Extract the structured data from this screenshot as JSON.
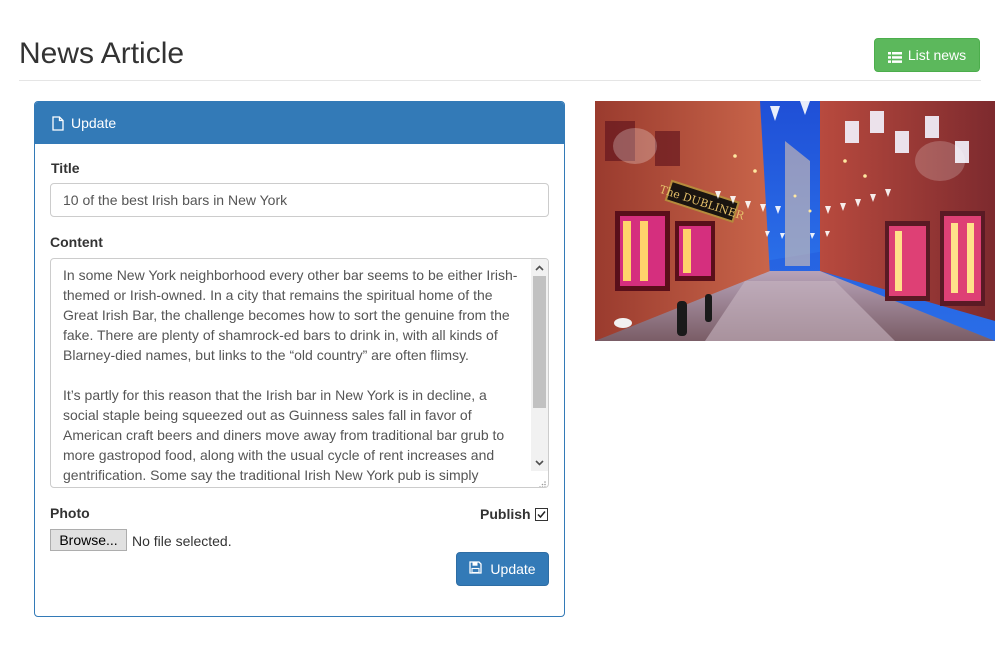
{
  "header": {
    "title": "News Article",
    "list_button_label": "List news"
  },
  "panel": {
    "heading": "Update",
    "title_label": "Title",
    "title_value": "10 of the best Irish bars in New York",
    "content_label": "Content",
    "content_value": "In some New York neighborhood every other bar seems to be either Irish-themed or Irish-owned. In a city that remains the spiritual home of the Great Irish Bar, the challenge becomes how to sort the genuine from the fake. There are plenty of shamrock-ed bars to drink in, with all kinds of Blarney-died names, but links to the “old country” are often flimsy.\n\nIt’s partly for this reason that the Irish bar in New York is in decline, a social staple being squeezed out as Guinness sales fall in favor of American craft beers and diners move away from traditional bar grub to more gastropod food, along with the usual cycle of rent increases and gentrification. Some say the traditional Irish New York pub is simply",
    "photo_label": "Photo",
    "browse_label": "Browse...",
    "file_status": "No file selected.",
    "publish_label": "Publish",
    "publish_checked": true,
    "update_button_label": "Update"
  },
  "photo": {
    "sign_text": "The DUBLINER"
  },
  "colors": {
    "primary": "#337ab7",
    "success": "#5cb85c"
  },
  "icons": {
    "list_button": "list-icon",
    "heading": "file-icon",
    "update_button": "floppy-disk-icon"
  }
}
